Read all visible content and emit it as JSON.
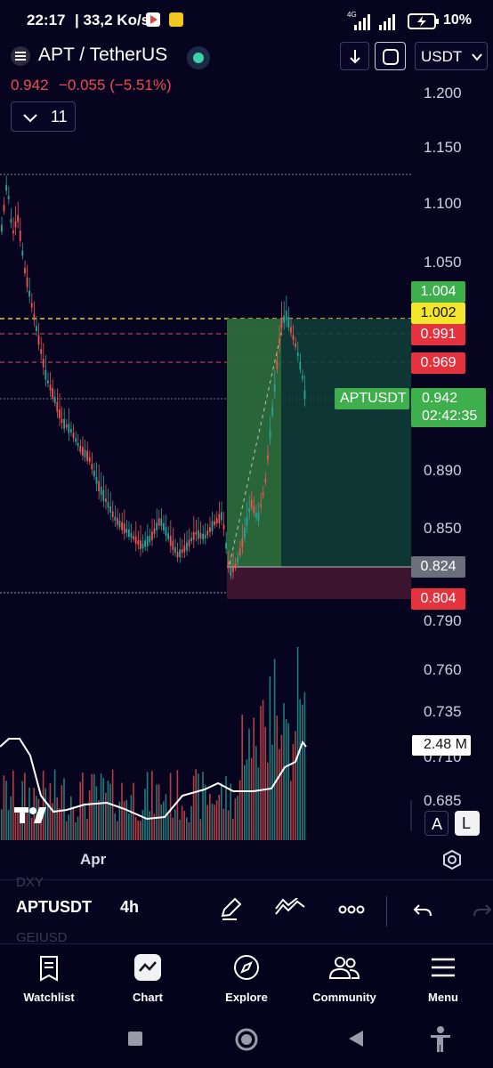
{
  "status_bar": {
    "time": "22:17",
    "speed": "| 33,2 Ko/s",
    "network": "4G",
    "battery": "10%"
  },
  "header": {
    "symbol_title": "APT / TetherUS",
    "currency": "USDT",
    "price": "0.942",
    "change": "−0.055 (−5.51%)",
    "interval_count": "11"
  },
  "price_axis": {
    "ticks": [
      "1.200",
      "1.150",
      "1.100",
      "1.050",
      "0.890",
      "0.850",
      "0.790",
      "0.760",
      "0.735",
      "0.710",
      "0.685"
    ]
  },
  "price_labels": {
    "target": "1.004",
    "entry_high": "1.002",
    "level_1": "0.991",
    "level_2": "0.969",
    "current_symbol": "APTUSDT",
    "current_price": "0.942",
    "countdown": "02:42:35",
    "stop_top": "0.824",
    "stop": "0.804",
    "volume": "2.48 M"
  },
  "time_axis": {
    "label": "Apr"
  },
  "scale_buttons": {
    "auto": "A",
    "log": "L"
  },
  "toolbar": {
    "symbol": "APTUSDT",
    "interval": "4h"
  },
  "background_list": {
    "above": "DXY",
    "below": "GEIUSD"
  },
  "nav": {
    "watchlist": "Watchlist",
    "chart": "Chart",
    "explore": "Explore",
    "community": "Community",
    "menu": "Menu"
  },
  "colors": {
    "background": "#06041f",
    "up": "#26a69a",
    "down": "#ef5350",
    "green_label": "#3fae4c",
    "red_label": "#e5323f",
    "yellow_label": "#f3e52b",
    "gray_label": "#6b6f7c"
  }
}
